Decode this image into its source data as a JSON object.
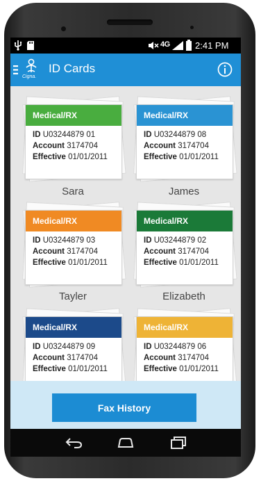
{
  "status": {
    "time": "2:41 PM",
    "network": "4G"
  },
  "appbar": {
    "title": "ID Cards",
    "logo_text": "Cigna."
  },
  "cards": [
    {
      "name": "Sara",
      "plan": "Medical/RX",
      "id_label": "ID",
      "id": "U03244879 01",
      "account_label": "Account",
      "account": "3174704",
      "effective_label": "Effective",
      "effective": "01/01/2011",
      "color": "#49ad3f"
    },
    {
      "name": "James",
      "plan": "Medical/RX",
      "id_label": "ID",
      "id": "U03244879 08",
      "account_label": "Account",
      "account": "3174704",
      "effective_label": "Effective",
      "effective": "01/01/2011",
      "color": "#2a93d3"
    },
    {
      "name": "Tayler",
      "plan": "Medical/RX",
      "id_label": "ID",
      "id": "U03244879 03",
      "account_label": "Account",
      "account": "3174704",
      "effective_label": "Effective",
      "effective": "01/01/2011",
      "color": "#f08a23"
    },
    {
      "name": "Elizabeth",
      "plan": "Medical/RX",
      "id_label": "ID",
      "id": "U03244879 02",
      "account_label": "Account",
      "account": "3174704",
      "effective_label": "Effective",
      "effective": "01/01/2011",
      "color": "#1b7a38"
    },
    {
      "name": "",
      "plan": "Medical/RX",
      "id_label": "ID",
      "id": "U03244879 09",
      "account_label": "Account",
      "account": "3174704",
      "effective_label": "Effective",
      "effective": "01/01/2011",
      "color": "#1c4a8a"
    },
    {
      "name": "",
      "plan": "Medical/RX",
      "id_label": "ID",
      "id": "U03244879 06",
      "account_label": "Account",
      "account": "3174704",
      "effective_label": "Effective",
      "effective": "01/01/2011",
      "color": "#eeb336"
    }
  ],
  "footer": {
    "fax_label": "Fax History"
  },
  "icons": {
    "menu": "menu-icon",
    "logo": "cigna-logo-icon",
    "info": "info-icon",
    "back": "back-icon",
    "home": "home-icon",
    "recents": "recents-icon",
    "usb": "usb-icon",
    "sd": "sd-card-icon",
    "mute": "mute-icon",
    "signal": "signal-icon",
    "battery": "battery-icon"
  },
  "colors": {
    "appbar": "#1f8fd6",
    "fax_button": "#1c8cd3",
    "footer_bg": "#cfe8f6"
  }
}
